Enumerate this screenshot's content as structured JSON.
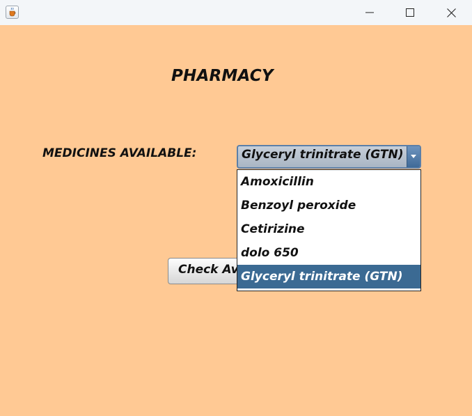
{
  "window": {
    "icon": "java-cup-icon",
    "controls": [
      "minimize-icon",
      "maximize-icon",
      "close-icon"
    ]
  },
  "main": {
    "title": "PHARMACY",
    "medicines_label": "MEDICINES AVAILABLE:",
    "combo_selected": "Glyceryl trinitrate (GTN)",
    "check_button_visible_text": "Check Av",
    "dropdown_items": [
      "Amoxicillin",
      "Benzoyl peroxide",
      "Cetirizine",
      "dolo 650",
      "Glyceryl trinitrate (GTN)"
    ],
    "selected_index": 4
  },
  "colors": {
    "background": "#FFC994",
    "selection": "#3B6A93",
    "titlebar": "#F3F6F9"
  }
}
